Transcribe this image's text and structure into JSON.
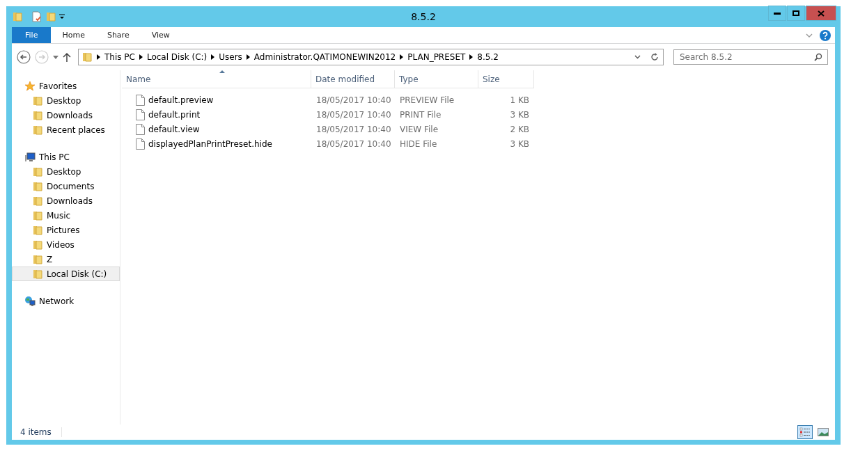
{
  "window": {
    "title": "8.5.2"
  },
  "ribbon_tabs": [
    {
      "label": "File",
      "kind": "file"
    },
    {
      "label": "Home",
      "kind": "tab"
    },
    {
      "label": "Share",
      "kind": "tab"
    },
    {
      "label": "View",
      "kind": "tab"
    }
  ],
  "address": {
    "crumbs": [
      "This PC",
      "Local Disk (C:)",
      "Users",
      "Administrator.QATIMONEWIN2012",
      "PLAN_PRESET",
      "8.5.2"
    ]
  },
  "search": {
    "placeholder": "Search 8.5.2"
  },
  "sidebar": [
    {
      "label": "Favorites",
      "items": [
        {
          "label": "Desktop",
          "selected": false
        },
        {
          "label": "Downloads",
          "selected": false
        },
        {
          "label": "Recent places",
          "selected": false
        }
      ]
    },
    {
      "label": "This PC",
      "items": [
        {
          "label": "Desktop",
          "selected": false
        },
        {
          "label": "Documents",
          "selected": false
        },
        {
          "label": "Downloads",
          "selected": false
        },
        {
          "label": "Music",
          "selected": false
        },
        {
          "label": "Pictures",
          "selected": false
        },
        {
          "label": "Videos",
          "selected": false
        },
        {
          "label": "Z",
          "selected": false
        },
        {
          "label": "Local Disk (C:)",
          "selected": true
        }
      ]
    },
    {
      "label": "Network"
    }
  ],
  "table": {
    "columns": [
      {
        "label": "Name",
        "sorted": true
      },
      {
        "label": "Date modified",
        "sorted": false
      },
      {
        "label": "Type",
        "sorted": false
      },
      {
        "label": "Size",
        "sorted": false
      }
    ],
    "rows": [
      {
        "name": "default.preview",
        "date": "18/05/2017 10:40",
        "type": "PREVIEW File",
        "size": "1 KB"
      },
      {
        "name": "default.print",
        "date": "18/05/2017 10:40",
        "type": "PRINT File",
        "size": "3 KB"
      },
      {
        "name": "default.view",
        "date": "18/05/2017 10:40",
        "type": "VIEW File",
        "size": "2 KB"
      },
      {
        "name": "displayedPlanPrintPreset.hide",
        "date": "18/05/2017 10:40",
        "type": "HIDE File",
        "size": "3 KB"
      }
    ]
  },
  "status_bar": {
    "text": "4 items",
    "views": [
      {
        "kind": "details",
        "selected": true
      },
      {
        "kind": "large",
        "selected": false
      }
    ]
  }
}
